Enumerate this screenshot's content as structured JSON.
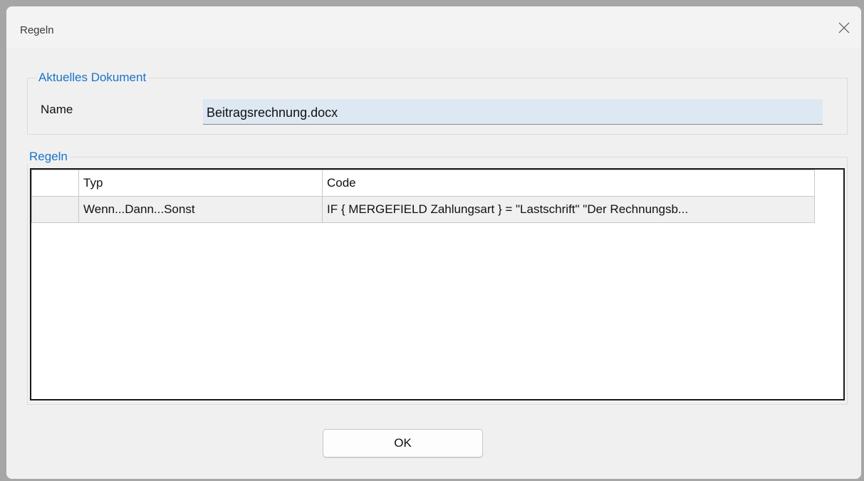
{
  "window": {
    "title": "Regeln",
    "close_icon": "close-icon"
  },
  "document_group": {
    "legend": "Aktuelles Dokument",
    "name_label": "Name",
    "name_value": "Beitragsrechnung.docx"
  },
  "rules_group": {
    "legend": "Regeln",
    "columns": [
      "",
      "Typ",
      "Code"
    ],
    "rows": [
      {
        "indicator": "",
        "typ": "Wenn...Dann...Sonst",
        "code": "IF { MERGEFIELD Zahlungsart } = \"Lastschrift\" \"Der Rechnungsb..."
      }
    ]
  },
  "ok_label": "OK",
  "colors": {
    "accent": "#1a73c9",
    "field_bg": "#dde8f2"
  }
}
